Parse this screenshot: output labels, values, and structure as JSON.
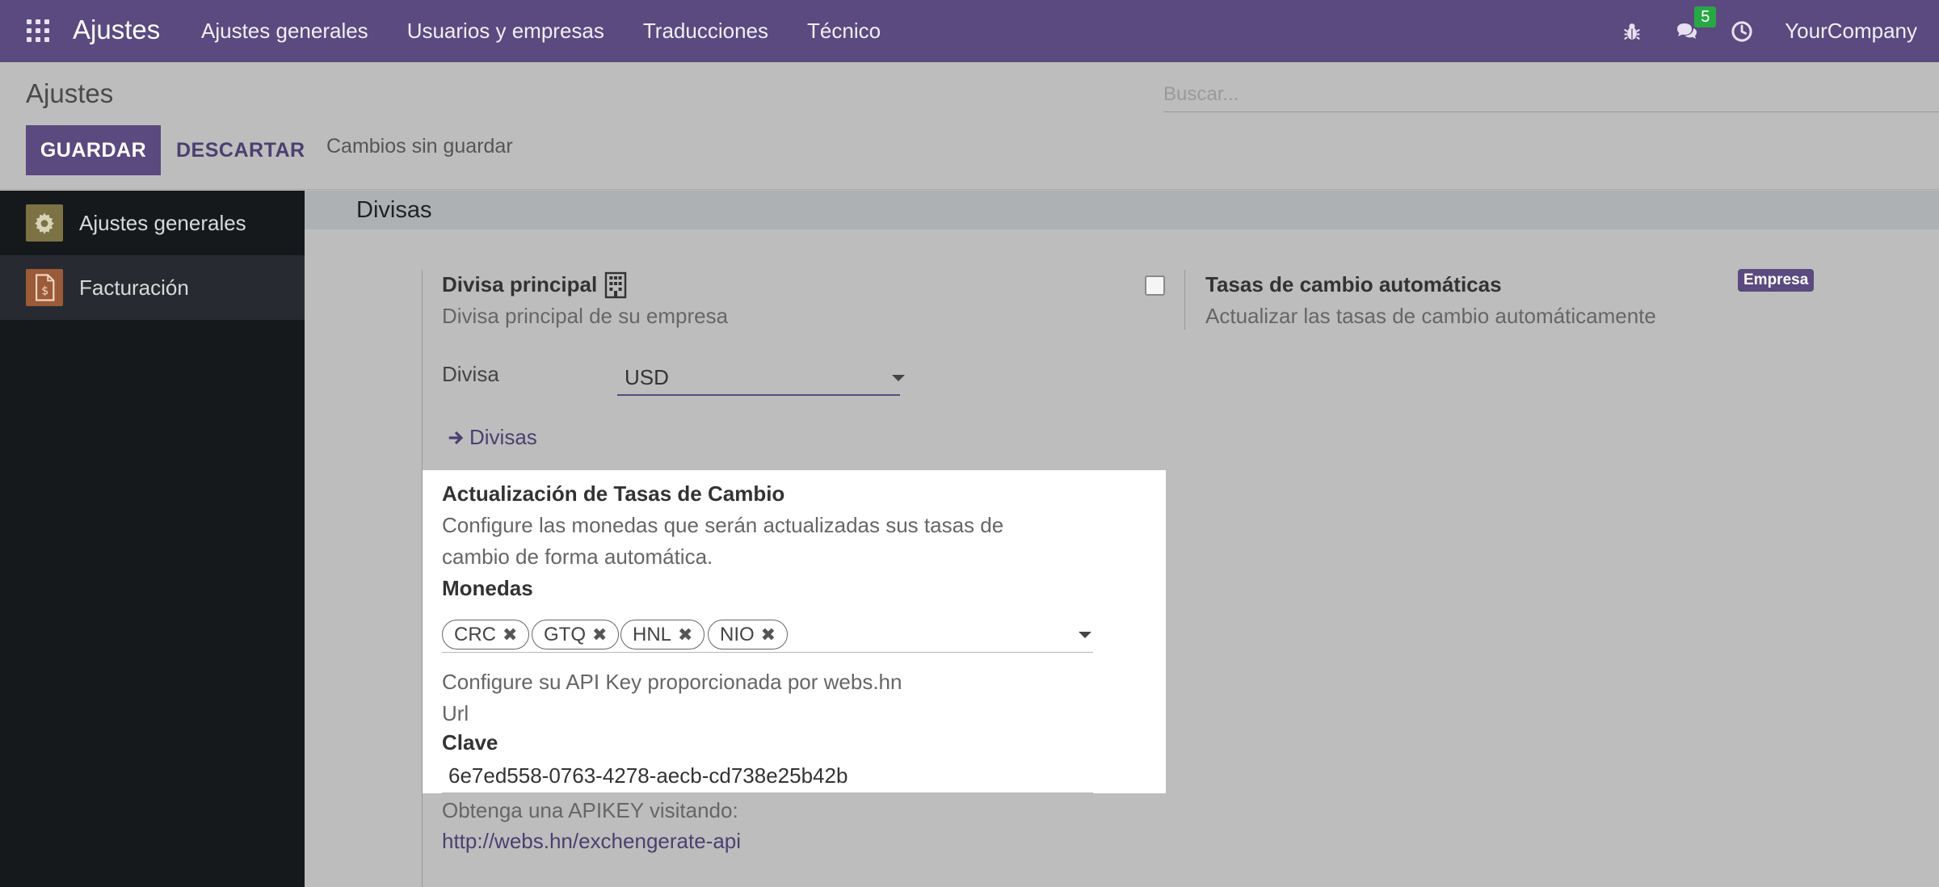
{
  "navbar": {
    "brand": "Ajustes",
    "menu": [
      "Ajustes generales",
      "Usuarios y empresas",
      "Traducciones",
      "Técnico"
    ],
    "message_count": "5",
    "company": "YourCompany"
  },
  "control_panel": {
    "title": "Ajustes",
    "search_placeholder": "Buscar...",
    "save_label": "GUARDAR",
    "discard_label": "DESCARTAR",
    "status": "Cambios sin guardar"
  },
  "sidebar": {
    "items": [
      {
        "label": "Ajustes generales",
        "icon": "gear-icon",
        "active": false
      },
      {
        "label": "Facturación",
        "icon": "invoice-icon",
        "active": true
      }
    ]
  },
  "section": {
    "title": "Divisas",
    "main_currency": {
      "title": "Divisa principal",
      "description": "Divisa principal de su empresa",
      "field_label": "Divisa",
      "value": "USD",
      "link": "Divisas"
    },
    "auto_rates": {
      "title": "Tasas de cambio automáticas",
      "description": "Actualizar las tasas de cambio automáticamente",
      "badge": "Empresa",
      "checked": false
    },
    "rate_update": {
      "title": "Actualización de Tasas de Cambio",
      "description_line1": "Configure las monedas que serán actualizadas sus tasas de",
      "description_line2": "cambio de forma automática.",
      "currencies_label": "Monedas",
      "currencies": [
        "CRC",
        "GTQ",
        "HNL",
        "NIO"
      ],
      "api_help": "Configure su API Key proporcionada por webs.hn",
      "url_label": "Url",
      "key_label": "Clave",
      "key_value": "6e7ed558-0763-4278-aecb-cd738e25b42b",
      "obtain_text": "Obtenga una APIKEY visitando:",
      "obtain_link": "http://webs.hn/exchengerate-api"
    }
  },
  "colors": {
    "navbar": "#5a4a7f",
    "primary": "#5a4a7f",
    "link": "#4c3f70",
    "sidebar": "#16191c",
    "badge_green": "#28a745"
  }
}
